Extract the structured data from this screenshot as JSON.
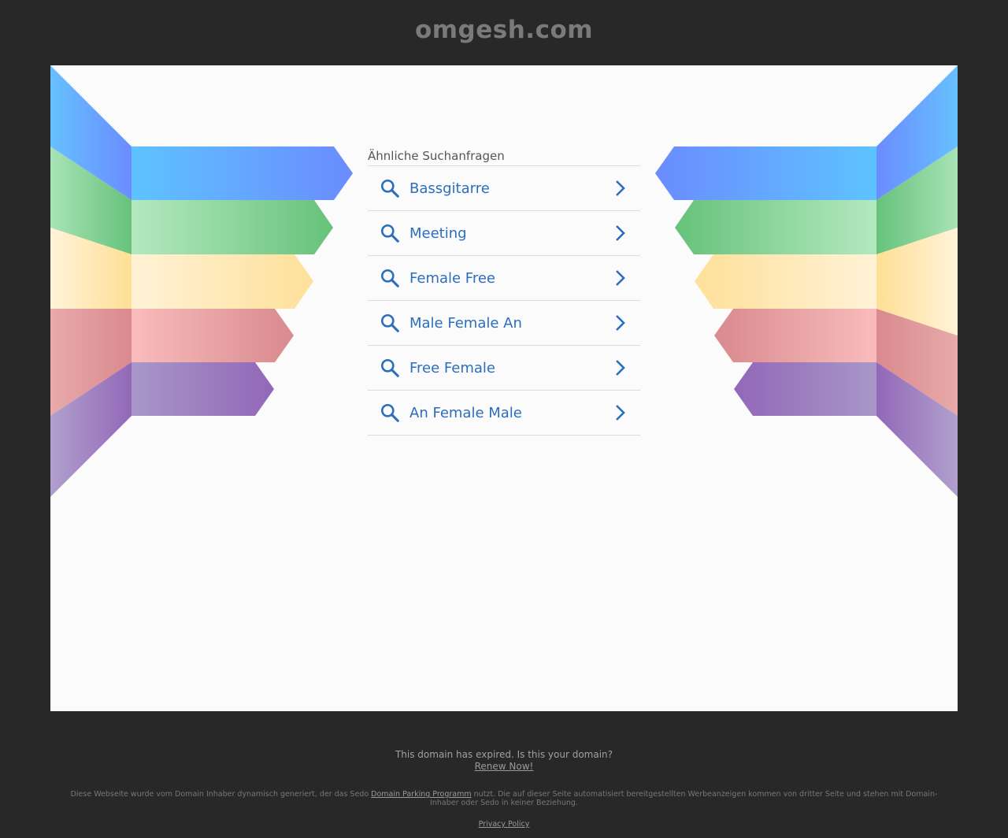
{
  "header": {
    "domain": "omgesh.com"
  },
  "related": {
    "heading": "Ähnliche Suchanfragen",
    "items": [
      {
        "label": "Bassgitarre"
      },
      {
        "label": "Meeting"
      },
      {
        "label": "Female Free"
      },
      {
        "label": "Male Female An"
      },
      {
        "label": "Free Female"
      },
      {
        "label": "An Female Male"
      }
    ]
  },
  "footer": {
    "expired_text": "This domain has expired. Is this your domain?",
    "renew_link": "Renew Now!",
    "disclaimer_before": "Diese Webseite wurde vom Domain Inhaber dynamisch generiert, der das Sedo ",
    "disclaimer_link": "Domain Parking Programm",
    "disclaimer_after": " nutzt. Die auf dieser Seite automatisiert bereitgestellten Werbeanzeigen kommen von dritter Seite und stehen mit Domain-Inhaber oder Sedo in keiner Beziehung.",
    "privacy_link": "Privacy Policy"
  },
  "colors": {
    "background": "#282828",
    "panel": "#fbfbfb",
    "link": "#2a6ebd",
    "stripe_blue": "#63a6ff",
    "stripe_green": "#7bd08e",
    "stripe_yellow": "#ffe4a6",
    "stripe_red": "#e8979b",
    "stripe_purple": "#9f7bbf"
  },
  "icons": {
    "item_left": "search-icon",
    "item_right": "chevron-right-icon"
  }
}
